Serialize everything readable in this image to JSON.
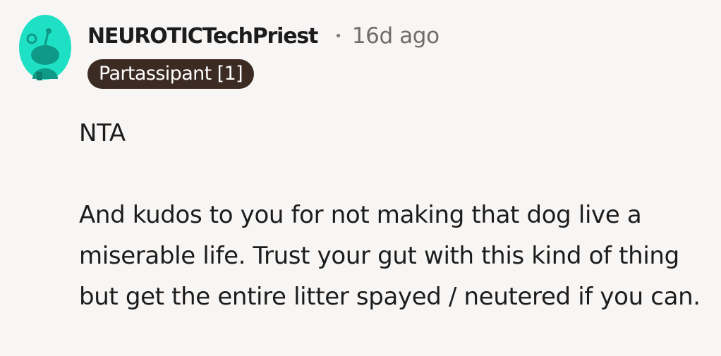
{
  "comment": {
    "username": "NEUROTICTechPriest",
    "separator": "•",
    "time_ago": "16d ago",
    "flair": "Partassipant [1]",
    "paragraphs": [
      "NTA",
      "And kudos to you for not making that dog live a miserable life. Trust your gut with this kind of thing but get the entire litter spayed / neutered if you can."
    ],
    "avatar_icon": "snoo-avatar-icon"
  },
  "colors": {
    "background": "#f8f6f5",
    "avatar_bg": "#1ee0c4",
    "avatar_figure": "#0e9a86",
    "flair_bg": "#3b2b22",
    "flair_text": "#ffffff",
    "meta_text": "#6f6c6a",
    "body_text": "#1c1c1c"
  }
}
